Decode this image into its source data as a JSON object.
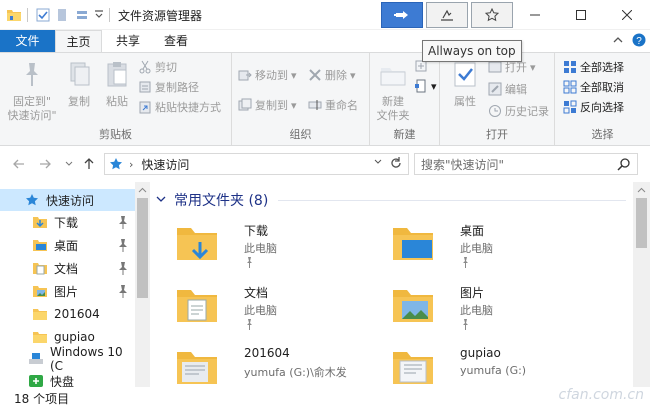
{
  "window": {
    "title": "文件资源管理器",
    "tooltip": "Allways on top"
  },
  "tabs": {
    "file": "文件",
    "home": "主页",
    "share": "共享",
    "view": "查看"
  },
  "ribbon": {
    "clipboard": {
      "label": "剪贴板",
      "pin_line1": "固定到\"",
      "pin_line2": "快速访问\"",
      "copy": "复制",
      "paste": "粘贴",
      "cut": "剪切",
      "copy_path": "复制路径",
      "paste_shortcut": "粘贴快捷方式"
    },
    "organize": {
      "label": "组织",
      "move_to": "移动到",
      "copy_to": "复制到",
      "delete": "删除",
      "rename": "重命名"
    },
    "new": {
      "label": "新建",
      "new_folder_line1": "新建",
      "new_folder_line2": "文件夹"
    },
    "open": {
      "label": "打开",
      "properties": "属性",
      "open": "打开",
      "edit": "编辑",
      "history": "历史记录"
    },
    "select": {
      "label": "选择",
      "select_all": "全部选择",
      "select_none": "全部取消",
      "invert": "反向选择"
    }
  },
  "address": {
    "path": "快速访问",
    "search_placeholder": "搜索\"快速访问\""
  },
  "nav": {
    "items": [
      {
        "label": "快速访问"
      },
      {
        "label": "下载"
      },
      {
        "label": "桌面"
      },
      {
        "label": "文档"
      },
      {
        "label": "图片"
      },
      {
        "label": "201604"
      },
      {
        "label": "gupiao"
      },
      {
        "label": "Windows 10 (C"
      },
      {
        "label": "快盘"
      }
    ]
  },
  "content": {
    "section_title": "常用文件夹 (8)",
    "tiles": [
      {
        "name": "下载",
        "sub": "此电脑"
      },
      {
        "name": "桌面",
        "sub": "此电脑"
      },
      {
        "name": "文档",
        "sub": "此电脑"
      },
      {
        "name": "图片",
        "sub": "此电脑"
      },
      {
        "name": "201604",
        "sub": "yumufa (G:)\\俞木发"
      },
      {
        "name": "gupiao",
        "sub": "yumufa (G:)"
      }
    ]
  },
  "status": {
    "count": "18 个项目"
  },
  "watermark": "cfan.com.cn",
  "colors": {
    "accent": "#1a73c7",
    "selection": "#cce8ff",
    "section_header": "#1e3287",
    "folder": "#f6c454"
  }
}
